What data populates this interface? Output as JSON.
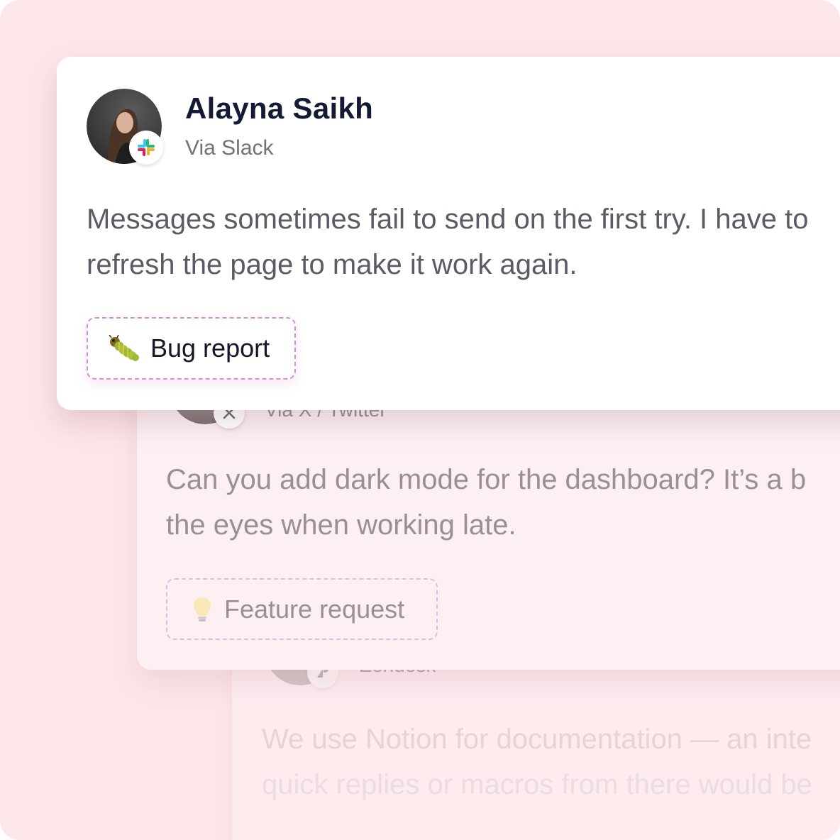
{
  "cards": [
    {
      "author": "Alayna Saikh",
      "source": "Via Slack",
      "source_icon": "slack-icon",
      "message_lines": [
        "Messages sometimes fail to send on the first try. I have to",
        "refresh the page to make it work again."
      ],
      "tag": {
        "label": "Bug report",
        "icon": "caterpillar-bug-icon"
      }
    },
    {
      "source": "Via X / Twitter",
      "source_icon": "x-icon",
      "message_lines": [
        "Can you add dark mode for the dashboard? It’s a b",
        "the eyes when working late."
      ],
      "tag": {
        "label": "Feature request",
        "icon": "lightbulb-icon"
      }
    },
    {
      "source": "Zendesk",
      "source_icon": "zendesk-icon",
      "message_lines": [
        "We use Notion for documentation — an inte",
        "quick replies or macros from there would be"
      ]
    }
  ],
  "colors": {
    "page_bg": "#fde6e9",
    "name_text": "#141a33",
    "body_text": "#5b5b66",
    "tag_border_gradient": [
      "#b98af0",
      "#ec64a9"
    ]
  }
}
